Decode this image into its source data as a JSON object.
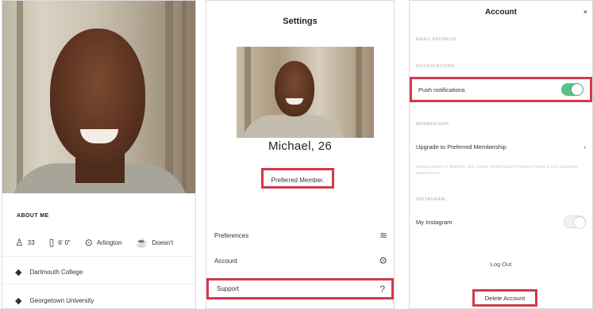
{
  "profile": {
    "about_label": "ABOUT ME",
    "stats": [
      {
        "icon": "cake-icon",
        "glyph": "♙",
        "value": "33"
      },
      {
        "icon": "height-icon",
        "glyph": "▯",
        "value": "6' 0\""
      },
      {
        "icon": "location-icon",
        "glyph": "⊙",
        "value": "Arlington"
      },
      {
        "icon": "smoking-icon",
        "glyph": "☕",
        "value": "Doesn't"
      }
    ],
    "education": [
      {
        "icon": "graduation-cap-icon",
        "glyph": "◆",
        "label": "Dartmouth College"
      },
      {
        "icon": "graduation-cap-icon",
        "glyph": "◆",
        "label": "Georgetown University"
      }
    ]
  },
  "settings": {
    "title": "Settings",
    "name_age": "Michael, 26",
    "member_badge": "Preferred Member.",
    "menu": [
      {
        "label": "Preferences",
        "icon": "sliders-icon",
        "glyph": "≋"
      },
      {
        "label": "Account",
        "icon": "gear-icon",
        "glyph": "⚙"
      },
      {
        "label": "Support",
        "icon": "question-icon",
        "glyph": "?"
      }
    ]
  },
  "account": {
    "title": "Account",
    "close_glyph": "×",
    "sections": {
      "email": "EMAIL ADDRESS",
      "notifications": "NOTIFICATIONS",
      "membership": "MEMBERSHIP",
      "instagram": "INSTAGRAM"
    },
    "push_label": "Push notifications",
    "push_enabled": true,
    "upgrade_label": "Upgrade to Preferred Membership",
    "upgrade_chevron": "›",
    "membership_desc": "Instant priority in Matches with Coffee Meets Bagel Preferred Service and awesome experiences.",
    "instagram_label": "My Instagram",
    "instagram_enabled": false,
    "logout_label": "Log Out",
    "delete_label": "Delete Account"
  },
  "colors": {
    "highlight": "#d23a4a",
    "toggle_on": "#5bbf8a"
  }
}
